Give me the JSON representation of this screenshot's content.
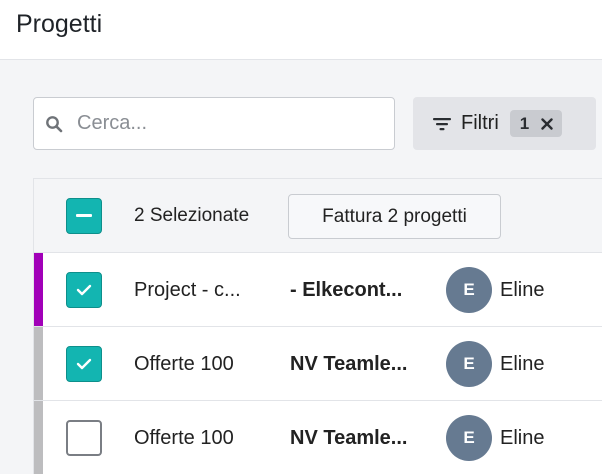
{
  "header": {
    "title": "Progetti"
  },
  "search": {
    "placeholder": "Cerca..."
  },
  "filters": {
    "label": "Filtri",
    "count": "1"
  },
  "table": {
    "selected_label": "2 Selezionate",
    "invoice_button": "Fattura 2 progetti",
    "rows": [
      {
        "project": "Project - c...",
        "client": "- Elkecont...",
        "avatar": "E",
        "user": "Eline",
        "checked": true,
        "stripe_color": "#a100b8"
      },
      {
        "project": "Offerte 100",
        "client": "NV Teamle...",
        "avatar": "E",
        "user": "Eline",
        "checked": true,
        "stripe_color": "#bdbdbf"
      },
      {
        "project": "Offerte 100",
        "client": "NV Teamle...",
        "avatar": "E",
        "user": "Eline",
        "checked": false,
        "stripe_color": "#bdbdbf"
      }
    ]
  },
  "colors": {
    "accent": "#13b5b1",
    "avatar": "#667a91"
  }
}
